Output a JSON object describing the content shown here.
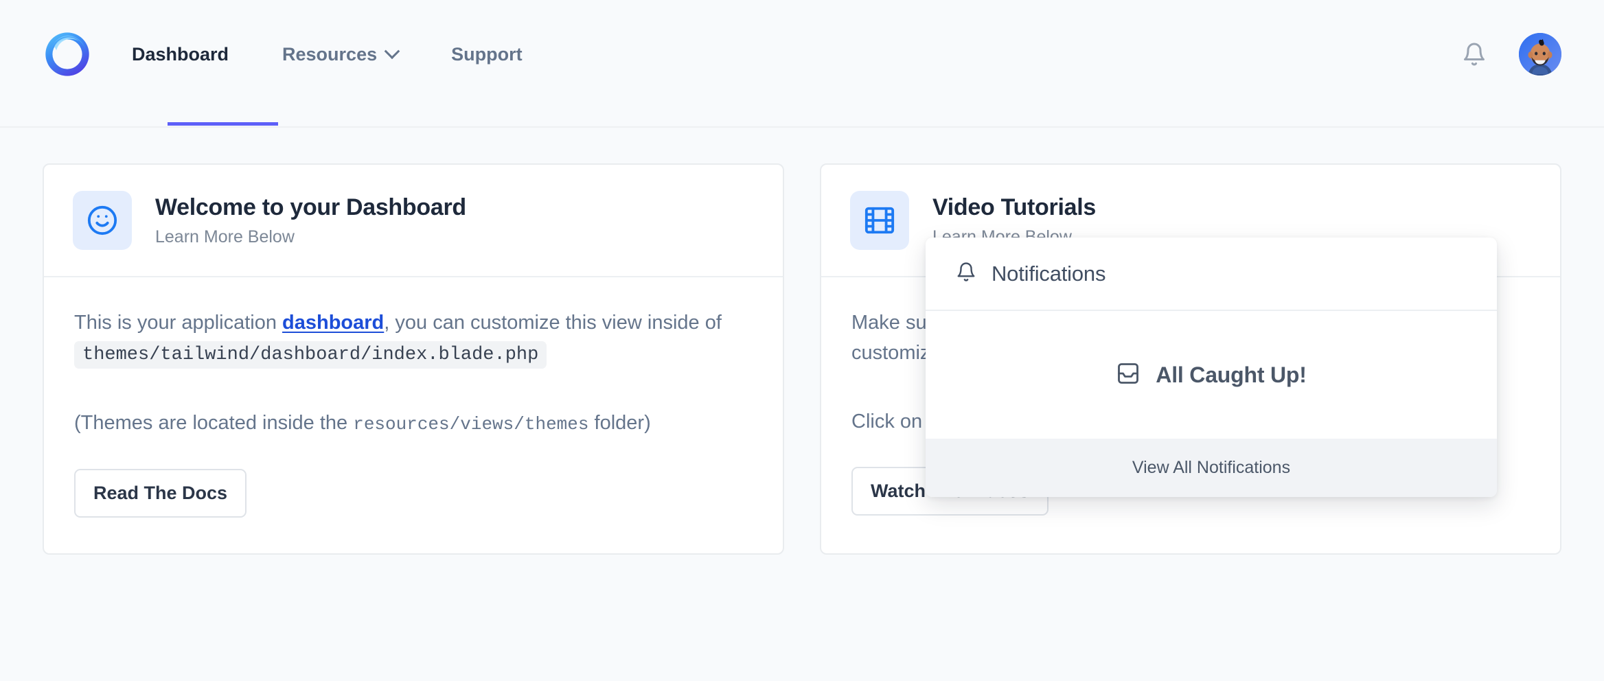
{
  "header": {
    "logo_name": "wave-logo",
    "nav": [
      {
        "label": "Dashboard",
        "active": true,
        "has_chevron": false
      },
      {
        "label": "Resources",
        "active": false,
        "has_chevron": true
      },
      {
        "label": "Support",
        "active": false,
        "has_chevron": false
      }
    ],
    "bell_icon": "bell-icon",
    "avatar_alt": "user-avatar",
    "active_underline_color": "#5d5ff8"
  },
  "notifications": {
    "title": "Notifications",
    "bell_icon": "bell-icon",
    "empty_icon": "inbox-icon",
    "empty_text": "All Caught Up!",
    "view_all_label": "View All Notifications"
  },
  "cards": [
    {
      "icon": "smiley-face-icon",
      "title": "Welcome to your Dashboard",
      "subtitle": "Learn More Below",
      "body": {
        "p1_before_link": "This is your application ",
        "p1_link": "dashboard",
        "p1_after_link": ", you can customize this view inside of ",
        "p1_code": "themes/tailwind/dashboard/index.blade.php",
        "p2_before_code": "(Themes are located inside the ",
        "p2_code": "resources/views/themes",
        "p2_after_code": " folder)"
      },
      "button": "Read The Docs"
    },
    {
      "icon": "film-strip-icon",
      "title": "Video Tutorials",
      "subtitle": "Learn More Below",
      "body": {
        "p1": "Make sure to watch the video tutorials to learn more how to use and customize Wave.",
        "p2": "Click on the button below to checkout the video tutorials."
      },
      "button": "Watch The Videos"
    }
  ],
  "colors": {
    "page_background": "#f8fafc",
    "card_background": "#ffffff",
    "accent_indigo": "#5d5ff8",
    "accent_blue": "#1d7af3",
    "link_blue": "#1d4ed8",
    "text_dark": "#1e293b",
    "text_muted": "#64748b"
  }
}
